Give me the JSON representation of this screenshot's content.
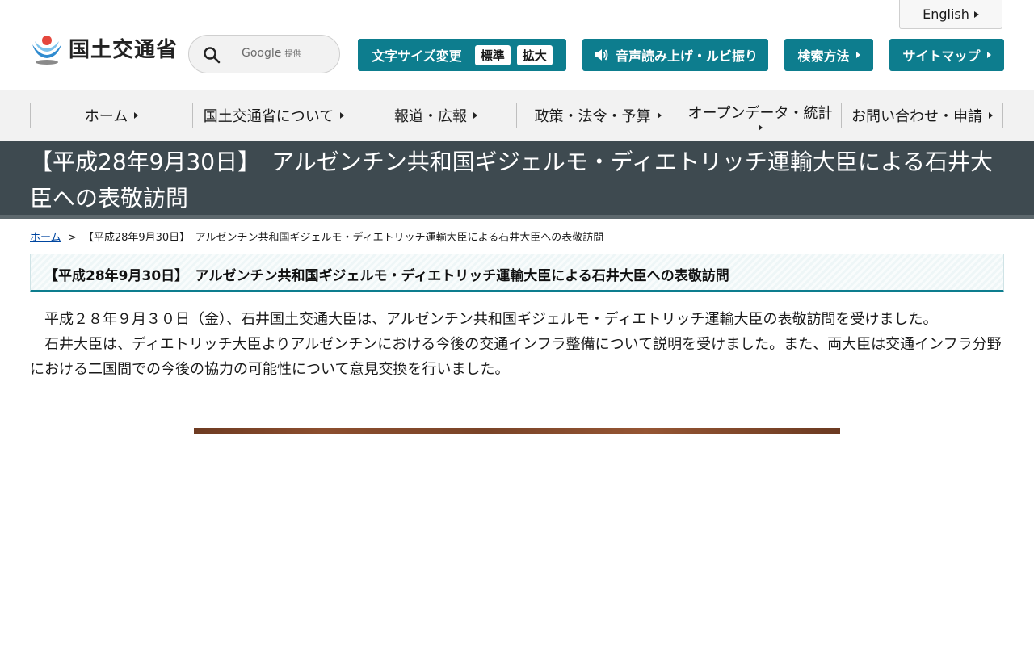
{
  "header": {
    "logo_text": "国土交通省",
    "language_label": "English",
    "search": {
      "provider": "Google",
      "provider_suffix": "提供",
      "placeholder": ""
    },
    "font_size": {
      "label": "文字サイズ変更",
      "standard": "標準",
      "large": "拡大"
    },
    "speech_label": "音声読み上げ・ルビ振り",
    "search_method_label": "検索方法",
    "sitemap_label": "サイトマップ",
    "accent_color": "#0d7d8e"
  },
  "nav": {
    "items": [
      {
        "label": "ホーム"
      },
      {
        "label": "国土交通省について"
      },
      {
        "label": "報道・広報"
      },
      {
        "label": "政策・法令・予算"
      },
      {
        "label": "オープンデータ・統計"
      },
      {
        "label": "お問い合わせ・申請"
      }
    ]
  },
  "page": {
    "banner_title": "【平成28年9月30日】　アルゼンチン共和国ギジェルモ・ディエトリッチ運輸大臣による石井大臣への表敬訪問",
    "breadcrumb": {
      "home": "ホーム",
      "separator": ">",
      "current": "【平成28年9月30日】　アルゼンチン共和国ギジェルモ・ディエトリッチ運輸大臣による石井大臣への表敬訪問"
    },
    "heading": "【平成28年9月30日】　アルゼンチン共和国ギジェルモ・ディエトリッチ運輸大臣による石井大臣への表敬訪問",
    "paragraphs": [
      "平成２８年９月３０日（金）、石井国土交通大臣は、アルゼンチン共和国ギジェルモ・ディエトリッチ運輸大臣の表敬訪問を受けました。",
      "石井大臣は、ディエトリッチ大臣よりアルゼンチンにおける今後の交通インフラ整備について説明を受けました。また、両大臣は交通インフラ分野における二国間での今後の協力の可能性について意見交換を行いました。"
    ]
  }
}
